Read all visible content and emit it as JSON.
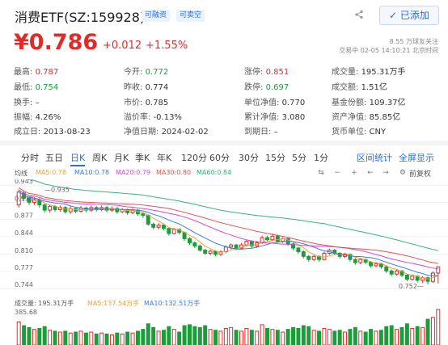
{
  "header": {
    "title": "消费ETF(SZ:159928)",
    "badge_margin": "可融资",
    "badge_short": "可卖空",
    "watchlist_label": "已添加"
  },
  "quote": {
    "price": "¥0.786",
    "change": "+0.012",
    "change_pct": "+1.55%",
    "followers": "8.55 万球友关注",
    "trade_status": "交易中 02-05 14:10:21 北京时间"
  },
  "stats": {
    "high": {
      "label": "最高:",
      "value": "0.787"
    },
    "low": {
      "label": "最低:",
      "value": "0.754"
    },
    "turnover_rate": {
      "label": "换手:",
      "value": "–"
    },
    "amplitude": {
      "label": "振幅:",
      "value": "4.26%"
    },
    "listing_date": {
      "label": "成立日:",
      "value": "2013-08-23"
    },
    "open": {
      "label": "今开:",
      "value": "0.772"
    },
    "prev_close": {
      "label": "昨收:",
      "value": "0.774"
    },
    "pe": {
      "label": "市价:",
      "value": "0.785"
    },
    "premium": {
      "label": "溢价率:",
      "value": "-0.13%"
    },
    "nav_date": {
      "label": "净值日期:",
      "value": "2024-02-02"
    },
    "limit_up": {
      "label": "涨停:",
      "value": "0.851"
    },
    "limit_down": {
      "label": "跌停:",
      "value": "0.697"
    },
    "unit_nav": {
      "label": "单位净值:",
      "value": "0.770"
    },
    "acc_nav": {
      "label": "累计净值:",
      "value": "3.080"
    },
    "maturity": {
      "label": "到期日:",
      "value": "–"
    },
    "volume": {
      "label": "成交量:",
      "value": "195.31万手"
    },
    "amount": {
      "label": "成交额:",
      "value": "1.51亿"
    },
    "fund_share": {
      "label": "基金份额:",
      "value": "109.37亿"
    },
    "assets": {
      "label": "资产净值:",
      "value": "85.85亿"
    },
    "currency": {
      "label": "货币单位:",
      "value": "CNY"
    }
  },
  "tabs": [
    "分时",
    "五日",
    "日K",
    "周K",
    "月K",
    "季K",
    "年K",
    "120分",
    "60分",
    "30分",
    "15分",
    "5分",
    "1分"
  ],
  "active_tab": "日K",
  "tab_links": {
    "interval_stats": "区间统计",
    "fullscreen": "全屏显示"
  },
  "ma_legend": {
    "label": "均线",
    "ma5": "MA5:0.78",
    "ma10": "MA10:0.78",
    "ma20": "MA20:0.79",
    "ma30": "MA30:0.80",
    "ma60": "MA60:0.84",
    "adjust": "前复权"
  },
  "colors": {
    "up": "#e02b2b",
    "down": "#1a9e3a",
    "ma5": "#e8a23b",
    "ma10": "#3b7ddd",
    "ma20": "#d24bd6",
    "ma30": "#e05555",
    "ma60": "#36b37e",
    "accent": "#2b6fd1"
  },
  "chart_data": {
    "type": "candlestick",
    "y_ticks": [
      "0.943",
      "0.910",
      "0.877",
      "0.844",
      "0.810",
      "0.777",
      "0.744"
    ],
    "annotations": {
      "high": "0.935",
      "low": "0.752"
    },
    "ylim": [
      0.735,
      0.948
    ],
    "volume_ylim": [
      0,
      385.68
    ],
    "candles": [
      [
        0.905,
        0.93,
        0.935,
        0.9,
        250
      ],
      [
        0.928,
        0.918,
        0.932,
        0.912,
        210
      ],
      [
        0.918,
        0.91,
        0.922,
        0.905,
        190
      ],
      [
        0.91,
        0.915,
        0.92,
        0.905,
        170
      ],
      [
        0.915,
        0.905,
        0.918,
        0.9,
        180
      ],
      [
        0.905,
        0.895,
        0.908,
        0.89,
        200
      ],
      [
        0.895,
        0.902,
        0.906,
        0.89,
        160
      ],
      [
        0.902,
        0.896,
        0.905,
        0.892,
        150
      ],
      [
        0.896,
        0.9,
        0.904,
        0.892,
        140
      ],
      [
        0.9,
        0.892,
        0.903,
        0.888,
        150
      ],
      [
        0.892,
        0.898,
        0.902,
        0.888,
        130
      ],
      [
        0.898,
        0.893,
        0.901,
        0.889,
        140
      ],
      [
        0.893,
        0.899,
        0.903,
        0.89,
        150
      ],
      [
        0.899,
        0.895,
        0.902,
        0.891,
        130
      ],
      [
        0.895,
        0.9,
        0.904,
        0.892,
        140
      ],
      [
        0.9,
        0.896,
        0.903,
        0.892,
        120
      ],
      [
        0.896,
        0.9,
        0.904,
        0.893,
        130
      ],
      [
        0.9,
        0.895,
        0.903,
        0.891,
        120
      ],
      [
        0.895,
        0.898,
        0.902,
        0.892,
        110
      ],
      [
        0.898,
        0.892,
        0.901,
        0.888,
        130
      ],
      [
        0.892,
        0.896,
        0.899,
        0.889,
        120
      ],
      [
        0.896,
        0.89,
        0.898,
        0.886,
        140
      ],
      [
        0.89,
        0.895,
        0.898,
        0.887,
        130
      ],
      [
        0.895,
        0.888,
        0.897,
        0.884,
        150
      ],
      [
        0.888,
        0.885,
        0.891,
        0.88,
        170
      ],
      [
        0.885,
        0.868,
        0.887,
        0.865,
        230
      ],
      [
        0.868,
        0.862,
        0.871,
        0.858,
        190
      ],
      [
        0.862,
        0.866,
        0.87,
        0.858,
        150
      ],
      [
        0.866,
        0.86,
        0.869,
        0.856,
        160
      ],
      [
        0.86,
        0.85,
        0.862,
        0.846,
        200
      ],
      [
        0.85,
        0.858,
        0.861,
        0.848,
        170
      ],
      [
        0.858,
        0.852,
        0.86,
        0.848,
        140
      ],
      [
        0.852,
        0.84,
        0.854,
        0.836,
        210
      ],
      [
        0.84,
        0.832,
        0.843,
        0.828,
        220
      ],
      [
        0.832,
        0.826,
        0.835,
        0.822,
        200
      ],
      [
        0.826,
        0.818,
        0.829,
        0.815,
        190
      ],
      [
        0.818,
        0.812,
        0.821,
        0.809,
        210
      ],
      [
        0.812,
        0.816,
        0.819,
        0.808,
        170
      ],
      [
        0.816,
        0.81,
        0.818,
        0.806,
        160
      ],
      [
        0.81,
        0.815,
        0.818,
        0.807,
        150
      ],
      [
        0.815,
        0.824,
        0.827,
        0.812,
        180
      ],
      [
        0.824,
        0.828,
        0.831,
        0.82,
        190
      ],
      [
        0.828,
        0.822,
        0.83,
        0.818,
        160
      ],
      [
        0.822,
        0.828,
        0.832,
        0.819,
        150
      ],
      [
        0.828,
        0.835,
        0.838,
        0.825,
        180
      ],
      [
        0.835,
        0.826,
        0.837,
        0.822,
        160
      ],
      [
        0.826,
        0.832,
        0.836,
        0.823,
        150
      ],
      [
        0.832,
        0.842,
        0.846,
        0.83,
        220
      ],
      [
        0.842,
        0.838,
        0.846,
        0.834,
        180
      ],
      [
        0.838,
        0.845,
        0.85,
        0.835,
        170
      ],
      [
        0.845,
        0.835,
        0.848,
        0.832,
        160
      ],
      [
        0.835,
        0.84,
        0.843,
        0.832,
        140
      ],
      [
        0.84,
        0.83,
        0.842,
        0.826,
        170
      ],
      [
        0.83,
        0.822,
        0.833,
        0.818,
        190
      ],
      [
        0.822,
        0.815,
        0.825,
        0.811,
        180
      ],
      [
        0.815,
        0.806,
        0.818,
        0.802,
        210
      ],
      [
        0.806,
        0.8,
        0.809,
        0.796,
        200
      ],
      [
        0.8,
        0.806,
        0.809,
        0.797,
        160
      ],
      [
        0.806,
        0.8,
        0.808,
        0.796,
        150
      ],
      [
        0.8,
        0.812,
        0.815,
        0.798,
        180
      ],
      [
        0.812,
        0.818,
        0.821,
        0.809,
        170
      ],
      [
        0.818,
        0.812,
        0.82,
        0.808,
        150
      ],
      [
        0.812,
        0.806,
        0.814,
        0.802,
        160
      ],
      [
        0.806,
        0.81,
        0.813,
        0.803,
        140
      ],
      [
        0.81,
        0.8,
        0.812,
        0.796,
        170
      ],
      [
        0.8,
        0.794,
        0.803,
        0.79,
        190
      ],
      [
        0.794,
        0.8,
        0.803,
        0.791,
        150
      ],
      [
        0.8,
        0.795,
        0.802,
        0.791,
        140
      ],
      [
        0.795,
        0.788,
        0.797,
        0.784,
        170
      ],
      [
        0.788,
        0.792,
        0.795,
        0.785,
        150
      ],
      [
        0.792,
        0.786,
        0.794,
        0.782,
        160
      ],
      [
        0.786,
        0.778,
        0.789,
        0.774,
        200
      ],
      [
        0.778,
        0.772,
        0.781,
        0.768,
        210
      ],
      [
        0.772,
        0.778,
        0.781,
        0.769,
        170
      ],
      [
        0.778,
        0.77,
        0.78,
        0.766,
        190
      ],
      [
        0.77,
        0.762,
        0.772,
        0.758,
        230
      ],
      [
        0.762,
        0.768,
        0.771,
        0.759,
        180
      ],
      [
        0.768,
        0.76,
        0.77,
        0.756,
        200
      ],
      [
        0.76,
        0.765,
        0.768,
        0.755,
        190
      ],
      [
        0.765,
        0.758,
        0.767,
        0.752,
        280
      ],
      [
        0.758,
        0.774,
        0.777,
        0.755,
        300
      ],
      [
        0.774,
        0.786,
        0.787,
        0.754,
        385
      ]
    ]
  }
}
